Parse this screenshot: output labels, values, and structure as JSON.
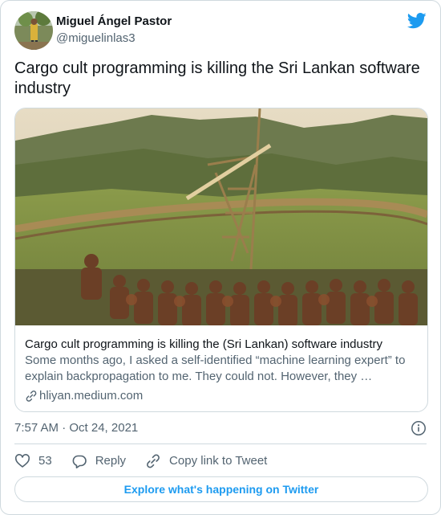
{
  "author": {
    "display_name": "Miguel Ángel Pastor",
    "handle": "@miguelinlas3"
  },
  "tweet": {
    "text": "Cargo cult programming is killing the Sri Lankan software industry"
  },
  "link_card": {
    "title": "Cargo cult programming is killing the (Sri Lankan) software industry",
    "description": "Some months ago, I asked a self-identified “machine learning expert” to explain backpropagation to me. They could not. However, they …",
    "domain": "hliyan.medium.com"
  },
  "timestamp": "7:57 AM · Oct 24, 2021",
  "actions": {
    "like_count": "53",
    "reply_label": "Reply",
    "copy_link_label": "Copy link to Tweet"
  },
  "explore_label": "Explore what's happening on Twitter",
  "colors": {
    "brand_blue": "#1d9bf0",
    "secondary_text": "#536471",
    "border": "#cfd9de"
  },
  "icons": [
    "brand-bird-icon",
    "link-icon",
    "info-icon",
    "heart-icon",
    "reply-icon",
    "copy-link-icon"
  ]
}
